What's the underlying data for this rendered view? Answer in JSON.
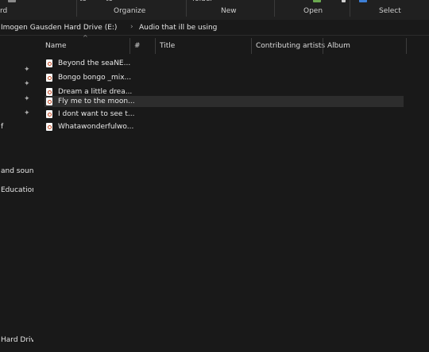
{
  "ribbon": {
    "top_fragments": [
      "to",
      "to",
      "folder"
    ],
    "groups": [
      "rd",
      "Organize",
      "New",
      "Open",
      "Select"
    ]
  },
  "address": {
    "crumbs": [
      "Imogen Gausden Hard Drive (E:)",
      "Audio that ill be using"
    ]
  },
  "nav": {
    "items": [
      "f",
      "and sound",
      "Education",
      "Hard Drive"
    ]
  },
  "columns": [
    "Name",
    "#",
    "Title",
    "Contributing artists",
    "Album"
  ],
  "files": [
    {
      "name": "Beyond the seaNE..."
    },
    {
      "name": "Bongo bongo _mix..."
    },
    {
      "name": "Dream a little drea..."
    },
    {
      "name": "Fly me to the moon...",
      "selected": true
    },
    {
      "name": "I dont want to see t..."
    },
    {
      "name": "Whatawonderfulwo..."
    }
  ],
  "colors": {
    "background": "#191919",
    "ribbon": "#202020",
    "selected_row": "#2d2d2d",
    "text": "#e8e8e8",
    "file_icon_accent": "#c64a23"
  }
}
